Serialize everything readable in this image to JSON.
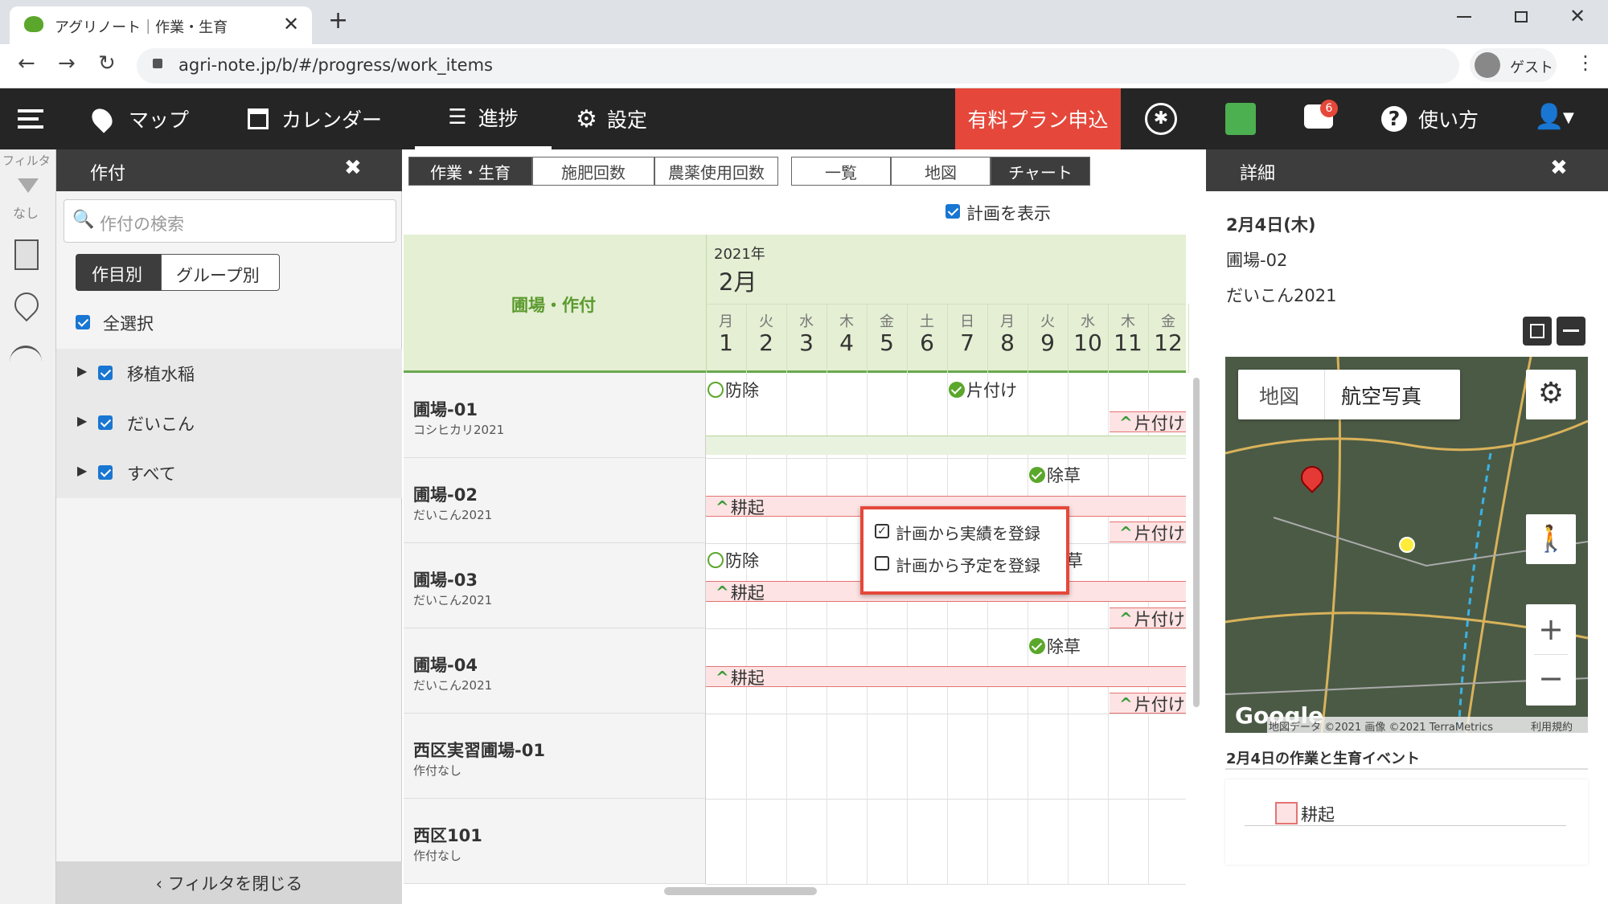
{
  "browser": {
    "tab_title": "アグリノート｜作業・生育",
    "url": "agri-note.jp/b/#/progress/work_items",
    "profile": "ゲスト"
  },
  "nav": {
    "map": "マップ",
    "calendar": "カレンダー",
    "progress": "進捗",
    "settings": "設定",
    "paid_plan": "有料プラン申込",
    "notifications": "6",
    "help": "使い方"
  },
  "rail": {
    "filter": "フィルタ",
    "none": "なし"
  },
  "filter": {
    "title": "作付",
    "search_placeholder": "作付の検索",
    "tab_crop": "作目別",
    "tab_group": "グループ別",
    "select_all": "全選択",
    "items": [
      "移植水稲",
      "だいこん",
      "すべて"
    ],
    "close": "フィルタを閉じる"
  },
  "center": {
    "tabs": [
      "作業・生育",
      "施肥回数",
      "農薬使用回数"
    ],
    "views": [
      "一覧",
      "地図",
      "チャート"
    ],
    "show_plan": "計画を表示",
    "col_header": "圃場・作付",
    "year": "2021年",
    "month": "2月",
    "days": [
      {
        "w": "月",
        "d": "1"
      },
      {
        "w": "火",
        "d": "2"
      },
      {
        "w": "水",
        "d": "3"
      },
      {
        "w": "木",
        "d": "4"
      },
      {
        "w": "金",
        "d": "5"
      },
      {
        "w": "土",
        "d": "6"
      },
      {
        "w": "日",
        "d": "7"
      },
      {
        "w": "月",
        "d": "8"
      },
      {
        "w": "火",
        "d": "9"
      },
      {
        "w": "水",
        "d": "10"
      },
      {
        "w": "木",
        "d": "11"
      },
      {
        "w": "金",
        "d": "12"
      }
    ],
    "rows": [
      {
        "name": "圃場-01",
        "sub": "コシヒカリ2021"
      },
      {
        "name": "圃場-02",
        "sub": "だいこん2021"
      },
      {
        "name": "圃場-03",
        "sub": "だいこん2021"
      },
      {
        "name": "圃場-04",
        "sub": "だいこん2021"
      },
      {
        "name": "西区実習圃場-01",
        "sub": "作付なし"
      },
      {
        "name": "西区101",
        "sub": "作付なし"
      }
    ],
    "events": {
      "bojo": "防除",
      "katazuke": "片付け",
      "josou": "除草",
      "kouki": "耕起",
      "partial": "草"
    },
    "popup": {
      "opt1": "計画から実績を登録",
      "opt2": "計画から予定を登録"
    }
  },
  "detail": {
    "title": "詳細",
    "date": "2月4日(木)",
    "field": "圃場-02",
    "crop": "だいこん2021",
    "map_tab": "地図",
    "sat_tab": "航空写真",
    "map_credit": "地図データ ©2021 画像 ©2021 TerraMetrics",
    "terms": "利用規約",
    "google": "Google",
    "events_title": "2月4日の作業と生育イベント",
    "event": "耕起"
  },
  "colors": {
    "accent_red": "#e5483b",
    "green": "#5ba72b",
    "header_bg": "#252525"
  }
}
